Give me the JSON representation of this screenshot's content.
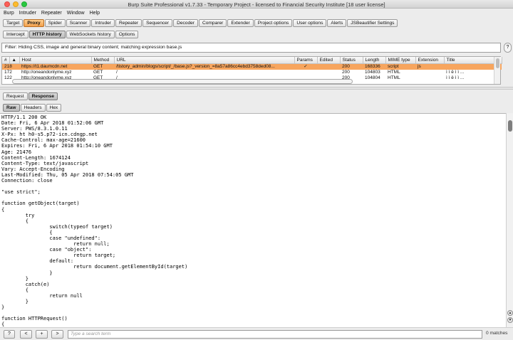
{
  "window": {
    "title": "Burp Suite Professional v1.7.33 - Temporary Project - licensed to Financial Security Institute [18 user license]"
  },
  "menu": [
    "Burp",
    "Intruder",
    "Repeater",
    "Window",
    "Help"
  ],
  "main_tabs": [
    "Target",
    "Proxy",
    "Spider",
    "Scanner",
    "Intruder",
    "Repeater",
    "Sequencer",
    "Decoder",
    "Comparer",
    "Extender",
    "Project options",
    "User options",
    "Alerts",
    "JSBeautifier Settings"
  ],
  "main_tab_selected": "Proxy",
  "proxy_tabs": [
    "Intercept",
    "HTTP history",
    "WebSockets history",
    "Options"
  ],
  "proxy_tab_selected": "HTTP history",
  "filter": {
    "text": "Filter: Hiding CSS, image and general binary content; matching expression base.js",
    "help_label": "?"
  },
  "history_table": {
    "columns": [
      "#",
      "▲",
      "Host",
      "Method",
      "URL",
      "Params",
      "Edited",
      "Status",
      "Length",
      "MIME type",
      "Extension",
      "Title"
    ],
    "rows": [
      {
        "num": "218",
        "host": "https://t1.daumcdn.net",
        "method": "GET",
        "url": "/tistory_admin/blogs/script/_/base.js?_version_=8a57a86cc4ebd3758ded08...",
        "params": "✓",
        "edited": "",
        "status": "200",
        "length": "168336",
        "mime": "script",
        "ext": "js",
        "title": "",
        "selected": true
      },
      {
        "num": "172",
        "host": "http://oneandonlyme.xyz",
        "method": "GET",
        "url": "/",
        "params": "",
        "edited": "",
        "status": "200",
        "length": "104803",
        "mime": "HTML",
        "ext": "",
        "title": "ì ì ë ì ì ...",
        "selected": false
      },
      {
        "num": "122",
        "host": "http://oneandonlyme.xyz",
        "method": "GET",
        "url": "/",
        "params": "",
        "edited": "",
        "status": "200",
        "length": "104804",
        "mime": "HTML",
        "ext": "",
        "title": "ì ì ë ì ì ...",
        "selected": false
      }
    ]
  },
  "message_tabs": [
    "Request",
    "Response"
  ],
  "message_tab_selected": "Response",
  "view_tabs": [
    "Raw",
    "Headers",
    "Hex"
  ],
  "view_tab_selected": "Raw",
  "response_body": "HTTP/1.1 200 OK\nDate: Fri, 6 Apr 2018 01:52:06 GMT\nServer: PWS/8.3.1.0.11\nX-Px: ht h0-s5.p72-icn.cdngp.net\nCache-Control: max-age=21600\nExpires: Fri, 6 Apr 2018 01:54:10 GMT\nAge: 21476\nContent-Length: 1674124\nContent-Type: text/javascript\nVary: Accept-Encoding\nLast-Modified: Thu, 05 Apr 2018 07:54:05 GMT\nConnection: close\n\n\"use strict\";\n\nfunction getObject(target)\n{\n        try\n        {\n                switch(typeof target)\n                {\n                case \"undefined\":\n                        return null;\n                case \"object\":\n                        return target;\n                default:\n                        return document.getElementById(target)\n                }\n        }\n        catch(e)\n        {\n                return null\n        }\n}\n\nfunction HTTPRequest()\n{\n        switch(arguments.length)",
  "bottom": {
    "buttons": [
      "?",
      "<",
      "+",
      ">"
    ],
    "search_placeholder": "Type a search term",
    "matches": "0 matches"
  }
}
